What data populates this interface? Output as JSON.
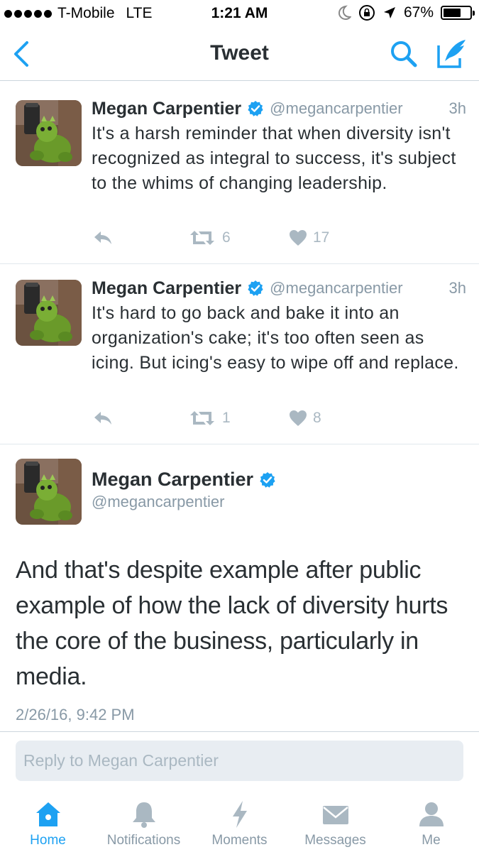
{
  "status_bar": {
    "carrier": "T-Mobile",
    "network": "LTE",
    "time": "1:21 AM",
    "battery": "67%",
    "battery_level": 0.67
  },
  "nav": {
    "title": "Tweet",
    "icons": [
      "back-chevron-icon",
      "search-icon",
      "compose-icon"
    ],
    "accent_color": "#1da1f2"
  },
  "replies": [
    {
      "name": "Megan Carpentier",
      "handle": "@megancarpentier",
      "time": "3h",
      "text": "It's a harsh reminder that when diversity isn't recognized as integral to success, it's subject to the whims of changing leadership.",
      "retweets": "6",
      "likes": "17"
    },
    {
      "name": "Megan Carpentier",
      "handle": "@megancarpentier",
      "time": "3h",
      "text": "It's hard to go back and bake it into an organization's cake; it's too often seen as icing. But icing's easy to wipe off and replace.",
      "retweets": "1",
      "likes": "8"
    }
  ],
  "main_tweet": {
    "name": "Megan Carpentier",
    "handle": "@megancarpentier",
    "text": "And that's despite example after public example of how the lack of diversity hurts the core of the business, particularly in media.",
    "timestamp": "2/26/16, 9:42 PM"
  },
  "reply_box": {
    "placeholder": "Reply to Megan Carpentier"
  },
  "tabs": [
    {
      "label": "Home",
      "icon": "home-icon",
      "active": true
    },
    {
      "label": "Notifications",
      "icon": "bell-icon",
      "active": false
    },
    {
      "label": "Moments",
      "icon": "lightning-icon",
      "active": false
    },
    {
      "label": "Messages",
      "icon": "envelope-icon",
      "active": false
    },
    {
      "label": "Me",
      "icon": "person-icon",
      "active": false
    }
  ]
}
